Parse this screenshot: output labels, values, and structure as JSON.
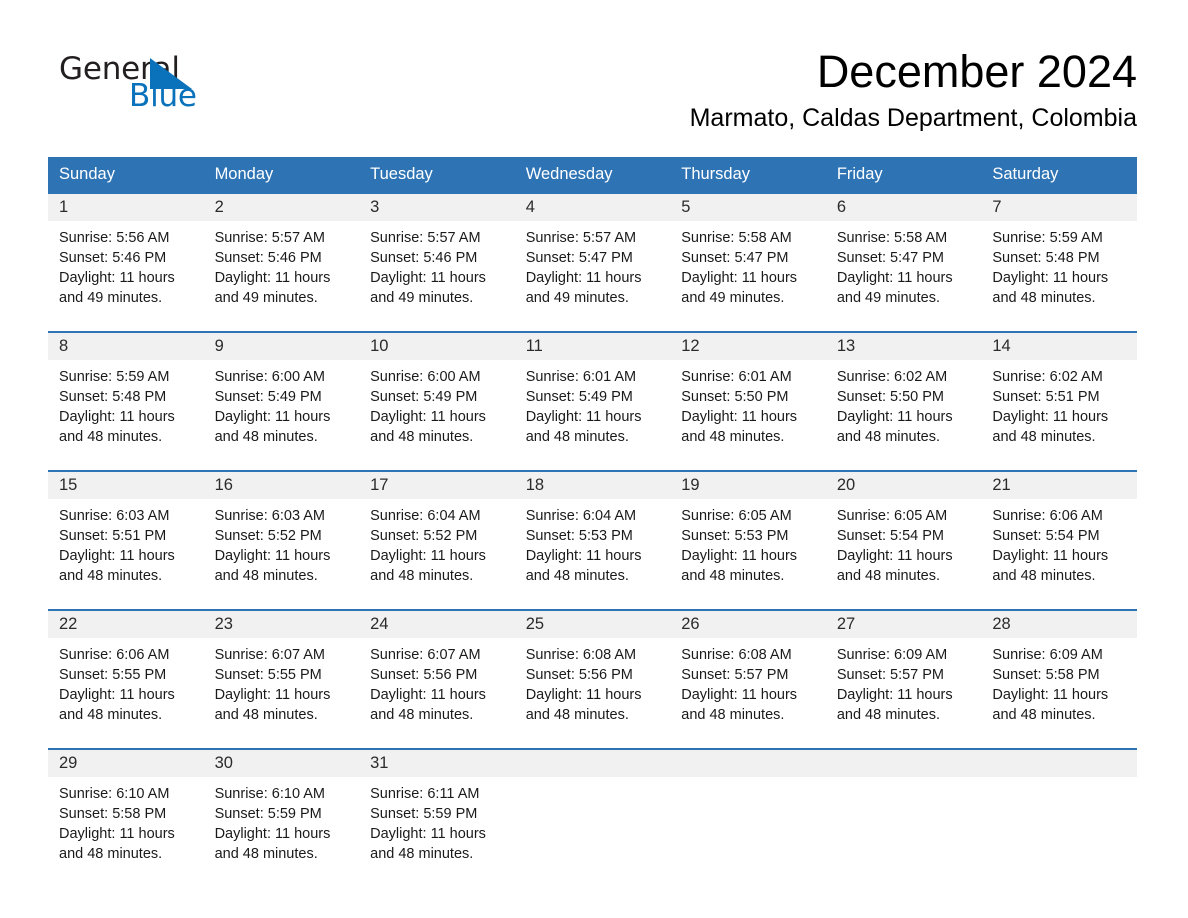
{
  "logo": {
    "line1": "General",
    "line2": "Blue",
    "triangle_color": "#0a72bb",
    "text_color": "#231f20"
  },
  "header": {
    "month_title": "December 2024",
    "location": "Marmato, Caldas Department, Colombia"
  },
  "theme": {
    "header_blue": "#2e74b5",
    "daynum_band": "#f1f1f1",
    "text": "#000000"
  },
  "weekday_headers": [
    "Sunday",
    "Monday",
    "Tuesday",
    "Wednesday",
    "Thursday",
    "Friday",
    "Saturday"
  ],
  "weeks": [
    [
      {
        "day": "1",
        "sunrise": "Sunrise: 5:56 AM",
        "sunset": "Sunset: 5:46 PM",
        "daylight": "Daylight: 11 hours and 49 minutes."
      },
      {
        "day": "2",
        "sunrise": "Sunrise: 5:57 AM",
        "sunset": "Sunset: 5:46 PM",
        "daylight": "Daylight: 11 hours and 49 minutes."
      },
      {
        "day": "3",
        "sunrise": "Sunrise: 5:57 AM",
        "sunset": "Sunset: 5:46 PM",
        "daylight": "Daylight: 11 hours and 49 minutes."
      },
      {
        "day": "4",
        "sunrise": "Sunrise: 5:57 AM",
        "sunset": "Sunset: 5:47 PM",
        "daylight": "Daylight: 11 hours and 49 minutes."
      },
      {
        "day": "5",
        "sunrise": "Sunrise: 5:58 AM",
        "sunset": "Sunset: 5:47 PM",
        "daylight": "Daylight: 11 hours and 49 minutes."
      },
      {
        "day": "6",
        "sunrise": "Sunrise: 5:58 AM",
        "sunset": "Sunset: 5:47 PM",
        "daylight": "Daylight: 11 hours and 49 minutes."
      },
      {
        "day": "7",
        "sunrise": "Sunrise: 5:59 AM",
        "sunset": "Sunset: 5:48 PM",
        "daylight": "Daylight: 11 hours and 48 minutes."
      }
    ],
    [
      {
        "day": "8",
        "sunrise": "Sunrise: 5:59 AM",
        "sunset": "Sunset: 5:48 PM",
        "daylight": "Daylight: 11 hours and 48 minutes."
      },
      {
        "day": "9",
        "sunrise": "Sunrise: 6:00 AM",
        "sunset": "Sunset: 5:49 PM",
        "daylight": "Daylight: 11 hours and 48 minutes."
      },
      {
        "day": "10",
        "sunrise": "Sunrise: 6:00 AM",
        "sunset": "Sunset: 5:49 PM",
        "daylight": "Daylight: 11 hours and 48 minutes."
      },
      {
        "day": "11",
        "sunrise": "Sunrise: 6:01 AM",
        "sunset": "Sunset: 5:49 PM",
        "daylight": "Daylight: 11 hours and 48 minutes."
      },
      {
        "day": "12",
        "sunrise": "Sunrise: 6:01 AM",
        "sunset": "Sunset: 5:50 PM",
        "daylight": "Daylight: 11 hours and 48 minutes."
      },
      {
        "day": "13",
        "sunrise": "Sunrise: 6:02 AM",
        "sunset": "Sunset: 5:50 PM",
        "daylight": "Daylight: 11 hours and 48 minutes."
      },
      {
        "day": "14",
        "sunrise": "Sunrise: 6:02 AM",
        "sunset": "Sunset: 5:51 PM",
        "daylight": "Daylight: 11 hours and 48 minutes."
      }
    ],
    [
      {
        "day": "15",
        "sunrise": "Sunrise: 6:03 AM",
        "sunset": "Sunset: 5:51 PM",
        "daylight": "Daylight: 11 hours and 48 minutes."
      },
      {
        "day": "16",
        "sunrise": "Sunrise: 6:03 AM",
        "sunset": "Sunset: 5:52 PM",
        "daylight": "Daylight: 11 hours and 48 minutes."
      },
      {
        "day": "17",
        "sunrise": "Sunrise: 6:04 AM",
        "sunset": "Sunset: 5:52 PM",
        "daylight": "Daylight: 11 hours and 48 minutes."
      },
      {
        "day": "18",
        "sunrise": "Sunrise: 6:04 AM",
        "sunset": "Sunset: 5:53 PM",
        "daylight": "Daylight: 11 hours and 48 minutes."
      },
      {
        "day": "19",
        "sunrise": "Sunrise: 6:05 AM",
        "sunset": "Sunset: 5:53 PM",
        "daylight": "Daylight: 11 hours and 48 minutes."
      },
      {
        "day": "20",
        "sunrise": "Sunrise: 6:05 AM",
        "sunset": "Sunset: 5:54 PM",
        "daylight": "Daylight: 11 hours and 48 minutes."
      },
      {
        "day": "21",
        "sunrise": "Sunrise: 6:06 AM",
        "sunset": "Sunset: 5:54 PM",
        "daylight": "Daylight: 11 hours and 48 minutes."
      }
    ],
    [
      {
        "day": "22",
        "sunrise": "Sunrise: 6:06 AM",
        "sunset": "Sunset: 5:55 PM",
        "daylight": "Daylight: 11 hours and 48 minutes."
      },
      {
        "day": "23",
        "sunrise": "Sunrise: 6:07 AM",
        "sunset": "Sunset: 5:55 PM",
        "daylight": "Daylight: 11 hours and 48 minutes."
      },
      {
        "day": "24",
        "sunrise": "Sunrise: 6:07 AM",
        "sunset": "Sunset: 5:56 PM",
        "daylight": "Daylight: 11 hours and 48 minutes."
      },
      {
        "day": "25",
        "sunrise": "Sunrise: 6:08 AM",
        "sunset": "Sunset: 5:56 PM",
        "daylight": "Daylight: 11 hours and 48 minutes."
      },
      {
        "day": "26",
        "sunrise": "Sunrise: 6:08 AM",
        "sunset": "Sunset: 5:57 PM",
        "daylight": "Daylight: 11 hours and 48 minutes."
      },
      {
        "day": "27",
        "sunrise": "Sunrise: 6:09 AM",
        "sunset": "Sunset: 5:57 PM",
        "daylight": "Daylight: 11 hours and 48 minutes."
      },
      {
        "day": "28",
        "sunrise": "Sunrise: 6:09 AM",
        "sunset": "Sunset: 5:58 PM",
        "daylight": "Daylight: 11 hours and 48 minutes."
      }
    ],
    [
      {
        "day": "29",
        "sunrise": "Sunrise: 6:10 AM",
        "sunset": "Sunset: 5:58 PM",
        "daylight": "Daylight: 11 hours and 48 minutes."
      },
      {
        "day": "30",
        "sunrise": "Sunrise: 6:10 AM",
        "sunset": "Sunset: 5:59 PM",
        "daylight": "Daylight: 11 hours and 48 minutes."
      },
      {
        "day": "31",
        "sunrise": "Sunrise: 6:11 AM",
        "sunset": "Sunset: 5:59 PM",
        "daylight": "Daylight: 11 hours and 48 minutes."
      },
      {
        "day": "",
        "sunrise": "",
        "sunset": "",
        "daylight": ""
      },
      {
        "day": "",
        "sunrise": "",
        "sunset": "",
        "daylight": ""
      },
      {
        "day": "",
        "sunrise": "",
        "sunset": "",
        "daylight": ""
      },
      {
        "day": "",
        "sunrise": "",
        "sunset": "",
        "daylight": ""
      }
    ]
  ]
}
